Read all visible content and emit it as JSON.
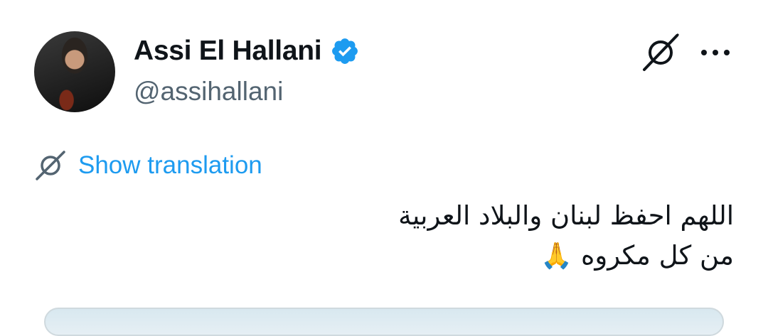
{
  "author": {
    "name": "Assi El Hallani",
    "handle": "@assihallani",
    "verified": true
  },
  "translate": {
    "label": "Show translation"
  },
  "tweet": {
    "line1": "اللهم احفظ لبنان والبلاد العربية",
    "line2": "من كل مكروه",
    "emoji": "🙏"
  },
  "colors": {
    "accent": "#1d9bf0",
    "text": "#0f1419",
    "secondary": "#536471"
  },
  "icons": {
    "verified": "verified-badge-icon",
    "grok": "grok-icon",
    "more": "more-options-icon",
    "translate": "grok-icon"
  }
}
